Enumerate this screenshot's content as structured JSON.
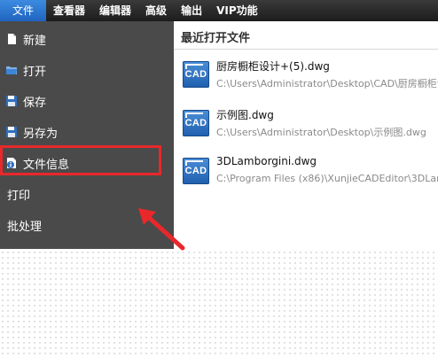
{
  "menubar": {
    "items": [
      "文件",
      "查看器",
      "编辑器",
      "高级",
      "输出",
      "VIP功能"
    ]
  },
  "sidebar": {
    "items": [
      {
        "label": "新建",
        "icon": "new-file-icon"
      },
      {
        "label": "打开",
        "icon": "open-folder-icon"
      },
      {
        "label": "保存",
        "icon": "save-disk-icon"
      },
      {
        "label": "另存为",
        "icon": "save-as-disk-icon"
      },
      {
        "label": "文件信息",
        "icon": "file-info-icon"
      },
      {
        "label": "打印",
        "icon": ""
      },
      {
        "label": "批处理",
        "icon": ""
      }
    ]
  },
  "recent": {
    "title": "最近打开文件",
    "files": [
      {
        "name": "厨房橱柜设计+(5).dwg",
        "path": "C:\\Users\\Administrator\\Desktop\\CAD\\厨房橱柜设计",
        "icon_text": "CAD"
      },
      {
        "name": "示例图.dwg",
        "path": "C:\\Users\\Administrator\\Desktop\\示例图.dwg",
        "icon_text": "CAD"
      },
      {
        "name": "3DLamborgini.dwg",
        "path": "C:\\Program Files (x86)\\XunjieCADEditor\\3DLambo",
        "icon_text": "CAD"
      }
    ]
  },
  "colors": {
    "highlight": "#e8282b",
    "sidebar_bg": "#4a4a4a",
    "menubar_active": "#2a74cf",
    "cad_icon": "#2f76c6"
  }
}
